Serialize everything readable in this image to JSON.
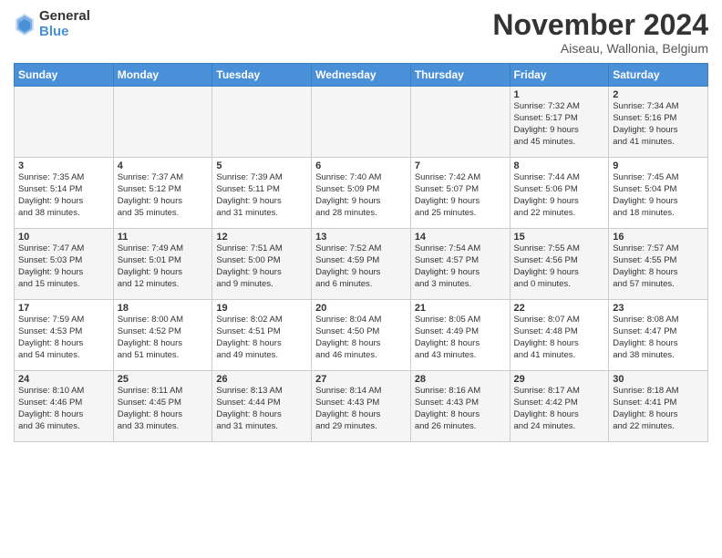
{
  "logo": {
    "general": "General",
    "blue": "Blue"
  },
  "title": "November 2024",
  "subtitle": "Aiseau, Wallonia, Belgium",
  "days_of_week": [
    "Sunday",
    "Monday",
    "Tuesday",
    "Wednesday",
    "Thursday",
    "Friday",
    "Saturday"
  ],
  "weeks": [
    {
      "days": [
        {
          "num": "",
          "info": ""
        },
        {
          "num": "",
          "info": ""
        },
        {
          "num": "",
          "info": ""
        },
        {
          "num": "",
          "info": ""
        },
        {
          "num": "",
          "info": ""
        },
        {
          "num": "1",
          "info": "Sunrise: 7:32 AM\nSunset: 5:17 PM\nDaylight: 9 hours\nand 45 minutes."
        },
        {
          "num": "2",
          "info": "Sunrise: 7:34 AM\nSunset: 5:16 PM\nDaylight: 9 hours\nand 41 minutes."
        }
      ]
    },
    {
      "days": [
        {
          "num": "3",
          "info": "Sunrise: 7:35 AM\nSunset: 5:14 PM\nDaylight: 9 hours\nand 38 minutes."
        },
        {
          "num": "4",
          "info": "Sunrise: 7:37 AM\nSunset: 5:12 PM\nDaylight: 9 hours\nand 35 minutes."
        },
        {
          "num": "5",
          "info": "Sunrise: 7:39 AM\nSunset: 5:11 PM\nDaylight: 9 hours\nand 31 minutes."
        },
        {
          "num": "6",
          "info": "Sunrise: 7:40 AM\nSunset: 5:09 PM\nDaylight: 9 hours\nand 28 minutes."
        },
        {
          "num": "7",
          "info": "Sunrise: 7:42 AM\nSunset: 5:07 PM\nDaylight: 9 hours\nand 25 minutes."
        },
        {
          "num": "8",
          "info": "Sunrise: 7:44 AM\nSunset: 5:06 PM\nDaylight: 9 hours\nand 22 minutes."
        },
        {
          "num": "9",
          "info": "Sunrise: 7:45 AM\nSunset: 5:04 PM\nDaylight: 9 hours\nand 18 minutes."
        }
      ]
    },
    {
      "days": [
        {
          "num": "10",
          "info": "Sunrise: 7:47 AM\nSunset: 5:03 PM\nDaylight: 9 hours\nand 15 minutes."
        },
        {
          "num": "11",
          "info": "Sunrise: 7:49 AM\nSunset: 5:01 PM\nDaylight: 9 hours\nand 12 minutes."
        },
        {
          "num": "12",
          "info": "Sunrise: 7:51 AM\nSunset: 5:00 PM\nDaylight: 9 hours\nand 9 minutes."
        },
        {
          "num": "13",
          "info": "Sunrise: 7:52 AM\nSunset: 4:59 PM\nDaylight: 9 hours\nand 6 minutes."
        },
        {
          "num": "14",
          "info": "Sunrise: 7:54 AM\nSunset: 4:57 PM\nDaylight: 9 hours\nand 3 minutes."
        },
        {
          "num": "15",
          "info": "Sunrise: 7:55 AM\nSunset: 4:56 PM\nDaylight: 9 hours\nand 0 minutes."
        },
        {
          "num": "16",
          "info": "Sunrise: 7:57 AM\nSunset: 4:55 PM\nDaylight: 8 hours\nand 57 minutes."
        }
      ]
    },
    {
      "days": [
        {
          "num": "17",
          "info": "Sunrise: 7:59 AM\nSunset: 4:53 PM\nDaylight: 8 hours\nand 54 minutes."
        },
        {
          "num": "18",
          "info": "Sunrise: 8:00 AM\nSunset: 4:52 PM\nDaylight: 8 hours\nand 51 minutes."
        },
        {
          "num": "19",
          "info": "Sunrise: 8:02 AM\nSunset: 4:51 PM\nDaylight: 8 hours\nand 49 minutes."
        },
        {
          "num": "20",
          "info": "Sunrise: 8:04 AM\nSunset: 4:50 PM\nDaylight: 8 hours\nand 46 minutes."
        },
        {
          "num": "21",
          "info": "Sunrise: 8:05 AM\nSunset: 4:49 PM\nDaylight: 8 hours\nand 43 minutes."
        },
        {
          "num": "22",
          "info": "Sunrise: 8:07 AM\nSunset: 4:48 PM\nDaylight: 8 hours\nand 41 minutes."
        },
        {
          "num": "23",
          "info": "Sunrise: 8:08 AM\nSunset: 4:47 PM\nDaylight: 8 hours\nand 38 minutes."
        }
      ]
    },
    {
      "days": [
        {
          "num": "24",
          "info": "Sunrise: 8:10 AM\nSunset: 4:46 PM\nDaylight: 8 hours\nand 36 minutes."
        },
        {
          "num": "25",
          "info": "Sunrise: 8:11 AM\nSunset: 4:45 PM\nDaylight: 8 hours\nand 33 minutes."
        },
        {
          "num": "26",
          "info": "Sunrise: 8:13 AM\nSunset: 4:44 PM\nDaylight: 8 hours\nand 31 minutes."
        },
        {
          "num": "27",
          "info": "Sunrise: 8:14 AM\nSunset: 4:43 PM\nDaylight: 8 hours\nand 29 minutes."
        },
        {
          "num": "28",
          "info": "Sunrise: 8:16 AM\nSunset: 4:43 PM\nDaylight: 8 hours\nand 26 minutes."
        },
        {
          "num": "29",
          "info": "Sunrise: 8:17 AM\nSunset: 4:42 PM\nDaylight: 8 hours\nand 24 minutes."
        },
        {
          "num": "30",
          "info": "Sunrise: 8:18 AM\nSunset: 4:41 PM\nDaylight: 8 hours\nand 22 minutes."
        }
      ]
    }
  ]
}
